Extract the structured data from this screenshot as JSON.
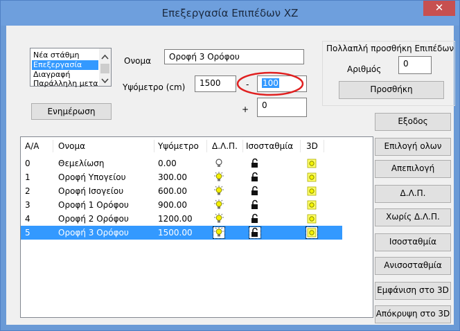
{
  "window": {
    "title": "Επεξεργασία Επιπέδων XZ",
    "close_glyph": "✕"
  },
  "modes": {
    "items": [
      "Νέα στάθμη",
      "Επεξεργασία",
      "Διαγραφή",
      "Παράλληλη μεταφορά"
    ],
    "selected_index": 1
  },
  "form": {
    "name_label": "Ονομα",
    "name_value": "Οροφή 3 Ορόφου",
    "height_label": "Υψόμετρο (cm)",
    "height_value": "1500",
    "minus_sign": "-",
    "minus_value": "100",
    "plus_sign": "+",
    "plus_value": "0",
    "update_button": "Ενημέρωση"
  },
  "multi": {
    "title": "Πολλαπλή προσθήκη Επιπέδων",
    "count_label": "Αριθμός",
    "count_value": "0",
    "add_button": "Προσθήκη"
  },
  "table": {
    "headers": [
      "Α/Α",
      "Ονομα",
      "Υψόμετρο",
      "Δ.Λ.Π.",
      "Ισοσταθμία",
      "3D"
    ],
    "rows": [
      {
        "aa": "0",
        "name": "Θεμελίωση",
        "height": "0.00"
      },
      {
        "aa": "1",
        "name": "Οροφή Υπογείου",
        "height": "300.00"
      },
      {
        "aa": "2",
        "name": "Οροφή Ισογείου",
        "height": "600.00"
      },
      {
        "aa": "3",
        "name": "Οροφή 1 Ορόφου",
        "height": "900.00"
      },
      {
        "aa": "4",
        "name": "Οροφή 2 Ορόφου",
        "height": "1200.00"
      },
      {
        "aa": "5",
        "name": "Οροφή 3 Ορόφου",
        "height": "1500.00"
      }
    ],
    "selected_index": 5
  },
  "side_buttons": {
    "exit": "Εξοδος",
    "select_all": "Επιλογή ολων",
    "deselect": "Απεπιλογή",
    "dlp": "Δ.Λ.Π.",
    "no_dlp": "Χωρίς Δ.Λ.Π.",
    "level": "Ισοσταθμία",
    "unlevel": "Ανισοσταθμία",
    "show3d": "Εμφάνιση στο 3D",
    "hide3d": "Απόκρυψη στο 3D"
  },
  "colors": {
    "accent": "#3399ff",
    "annotation": "#e02020",
    "titlebar": "#6e9fdd",
    "close": "#c75050"
  }
}
